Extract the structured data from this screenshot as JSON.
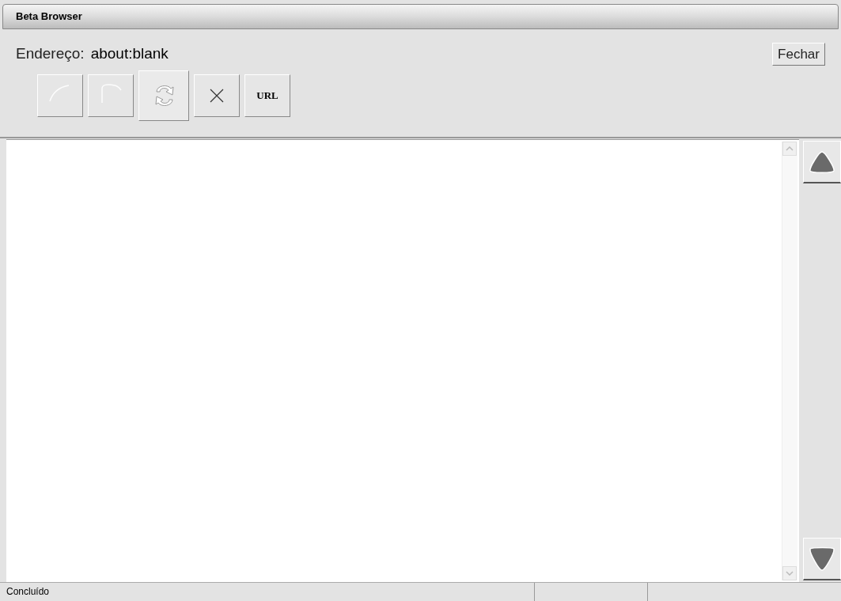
{
  "window": {
    "title": "Beta Browser"
  },
  "address": {
    "label": "Endereço:",
    "value": "about:blank"
  },
  "close_button": "Fechar",
  "toolbar": [
    {
      "kind": "back",
      "disabled": true,
      "highlighted": false
    },
    {
      "kind": "forward",
      "disabled": true,
      "highlighted": false
    },
    {
      "kind": "refresh",
      "disabled": false,
      "highlighted": true
    },
    {
      "kind": "stop",
      "disabled": false,
      "highlighted": false
    },
    {
      "kind": "url",
      "label": "URL",
      "disabled": false,
      "highlighted": false
    }
  ],
  "status_bar": {
    "text": "Concluído"
  }
}
